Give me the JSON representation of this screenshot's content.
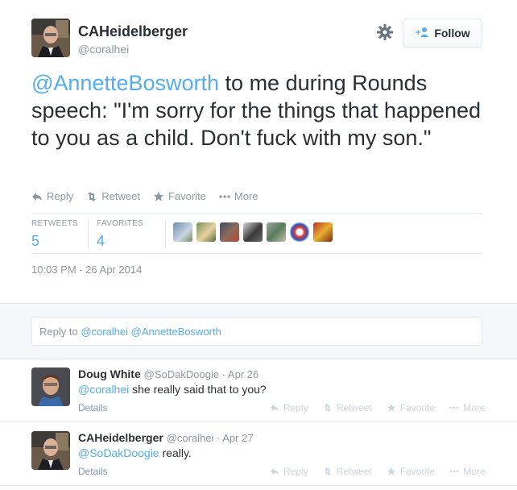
{
  "tweet": {
    "fullname": "CAHeidelberger",
    "username": "@coralhei",
    "follow_label": "Follow",
    "text_mention": "@AnnetteBosworth",
    "text_body": " to me during Rounds speech: \"I'm sorry for the things that happened to you as a child. Don't fuck with my son.\"",
    "actions": {
      "reply": "Reply",
      "retweet": "Retweet",
      "favorite": "Favorite",
      "more": "More"
    },
    "stats": {
      "retweets_label": "RETWEETS",
      "retweets_value": "5",
      "favorites_label": "FAVORITES",
      "favorites_value": "4"
    },
    "timestamp": "10:03 PM - 26 Apr 2014"
  },
  "reply_box": {
    "prefix": "Reply to ",
    "mentions": "@coralhei @AnnetteBosworth"
  },
  "replies": [
    {
      "name": "Doug White",
      "meta": "@SoDakDoogie · Apr 26",
      "mention": "@coralhei",
      "text": " she really said that to you?",
      "details": "Details"
    },
    {
      "name": "CAHeidelberger",
      "meta": "@coralhei · Apr 27",
      "mention": "@SoDakDoogie",
      "text": " really.",
      "details": "Details"
    }
  ],
  "reply_actions": {
    "reply": "Reply",
    "retweet": "Retweet",
    "favorite": "Favorite",
    "more": "More"
  },
  "colors": {
    "link": "#55acee",
    "muted": "#8899a6",
    "faint": "#ccd6dd",
    "border": "#e1e8ed"
  },
  "icons": [
    "settings-gear-icon",
    "follow-person-icon",
    "reply-icon",
    "retweet-icon",
    "favorite-star-icon",
    "more-dots-icon"
  ]
}
